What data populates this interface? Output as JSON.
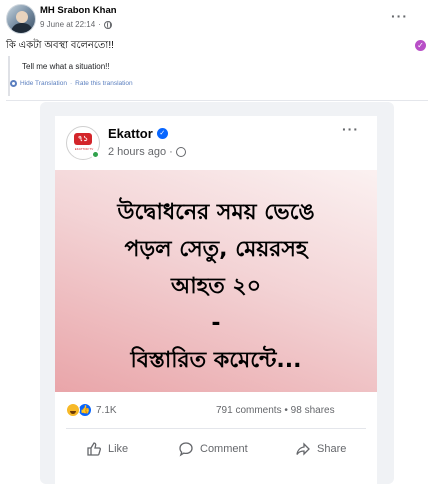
{
  "post": {
    "author": "MH Srabon Khan",
    "time": "9 June at 22:14",
    "dot": "·",
    "more": "···",
    "text": "কি একটা অবস্থা বলেনতো!!",
    "translation": "Tell me what a situation!!",
    "hide_translation": "Hide Translation",
    "separator": "·",
    "rate_translation": "Rate this translation",
    "badge": "✓"
  },
  "shared": {
    "page_name": "Ekattor",
    "verified": "✓",
    "logo_mark": "৭১",
    "logo_sub": "EKATTOR TV",
    "time": "2 hours ago",
    "dot": "·",
    "more": "···",
    "headline_lines": [
      "উদ্বোধনের সময় ভেঙে",
      "পড়ল সেতু, মেয়রসহ",
      "আহত ২০",
      "-",
      "বিস্তারিত কমেন্টে..."
    ],
    "reaction_count": "7.1K",
    "comments": "791 comments",
    "shares_sep": "•",
    "shares": "98 shares",
    "actions": {
      "like": "Like",
      "comment": "Comment",
      "share": "Share"
    }
  }
}
